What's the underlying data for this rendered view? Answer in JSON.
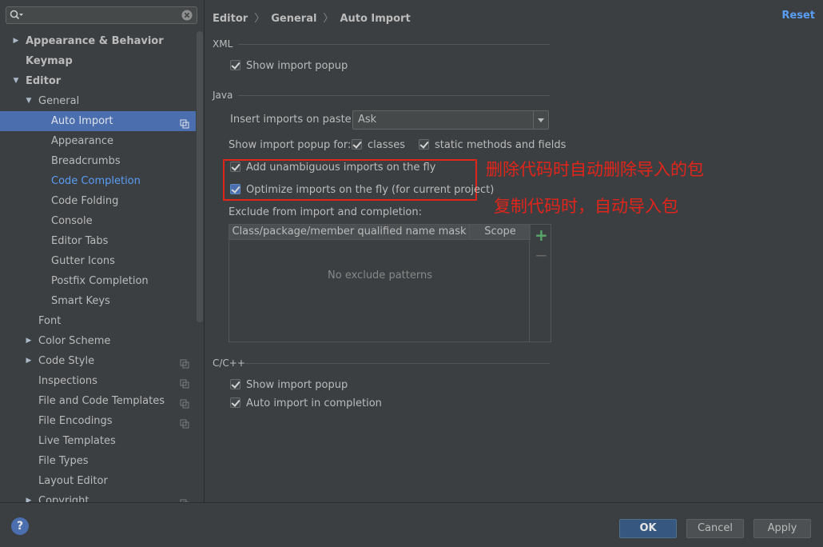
{
  "sidebar": {
    "search": {
      "value": "",
      "placeholder": ""
    },
    "items": [
      {
        "label": "Appearance & Behavior",
        "level": 0,
        "arrow": "▶",
        "bold": true
      },
      {
        "label": "Keymap",
        "level": 0,
        "arrow": "",
        "bold": true
      },
      {
        "label": "Editor",
        "level": 0,
        "arrow": "▼",
        "bold": true
      },
      {
        "label": "General",
        "level": 1,
        "arrow": "▼"
      },
      {
        "label": "Auto Import",
        "level": 2,
        "arrow": "",
        "selected": true,
        "project": true
      },
      {
        "label": "Appearance",
        "level": 2,
        "arrow": ""
      },
      {
        "label": "Breadcrumbs",
        "level": 2,
        "arrow": ""
      },
      {
        "label": "Code Completion",
        "level": 2,
        "arrow": "",
        "link": true
      },
      {
        "label": "Code Folding",
        "level": 2,
        "arrow": ""
      },
      {
        "label": "Console",
        "level": 2,
        "arrow": ""
      },
      {
        "label": "Editor Tabs",
        "level": 2,
        "arrow": ""
      },
      {
        "label": "Gutter Icons",
        "level": 2,
        "arrow": ""
      },
      {
        "label": "Postfix Completion",
        "level": 2,
        "arrow": ""
      },
      {
        "label": "Smart Keys",
        "level": 2,
        "arrow": ""
      },
      {
        "label": "Font",
        "level": 1,
        "arrow": ""
      },
      {
        "label": "Color Scheme",
        "level": 1,
        "arrow": "▶"
      },
      {
        "label": "Code Style",
        "level": 1,
        "arrow": "▶",
        "project": true
      },
      {
        "label": "Inspections",
        "level": 1,
        "arrow": "",
        "project": true
      },
      {
        "label": "File and Code Templates",
        "level": 1,
        "arrow": "",
        "project": true
      },
      {
        "label": "File Encodings",
        "level": 1,
        "arrow": "",
        "project": true
      },
      {
        "label": "Live Templates",
        "level": 1,
        "arrow": ""
      },
      {
        "label": "File Types",
        "level": 1,
        "arrow": ""
      },
      {
        "label": "Layout Editor",
        "level": 1,
        "arrow": ""
      },
      {
        "label": "Copyright",
        "level": 1,
        "arrow": "▶",
        "project": true
      }
    ]
  },
  "breadcrumb": {
    "part1": "Editor",
    "part2": "General",
    "part3": "Auto Import",
    "sep": "〉"
  },
  "reset_label": "Reset",
  "xml": {
    "title": "XML",
    "show_import_popup": "Show import popup"
  },
  "java": {
    "title": "Java",
    "insert_label": "Insert imports on paste:",
    "insert_value": "Ask",
    "popup_for_label": "Show import popup for:",
    "classes_label": "classes",
    "static_label": "static methods and fields",
    "add_unambiguous": "Add unambiguous imports on the fly",
    "optimize_imports": "Optimize imports on the fly (for current project)",
    "exclude_label": "Exclude from import and completion:",
    "table_col1": "Class/package/member qualified name mask",
    "table_col2": "Scope",
    "table_empty": "No exclude patterns"
  },
  "annotations": {
    "line1": "删除代码时自动删除导入的包",
    "line2": "复制代码时，自动导入包"
  },
  "cpp": {
    "title": "C/C++",
    "show_import_popup": "Show import popup",
    "auto_import": "Auto import in completion"
  },
  "buttons": {
    "ok": "OK",
    "cancel": "Cancel",
    "apply": "Apply",
    "help": "?"
  },
  "colors": {
    "background": "#3c3f41",
    "selection": "#4b6eaf",
    "link": "#589df6",
    "annotation_red": "#e0251b",
    "add_green": "#59a869"
  }
}
